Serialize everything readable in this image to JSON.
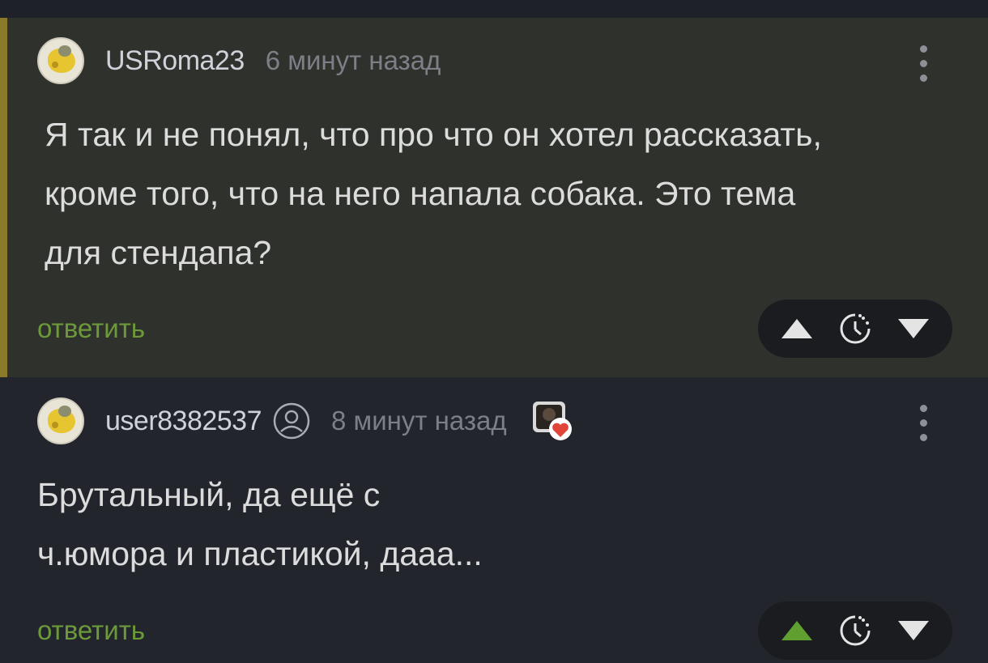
{
  "comments": [
    {
      "username": "USRoma23",
      "time": "6 минут назад",
      "text_lines": [
        "Я так и не понял, что про что он хотел рассказать,",
        "кроме того, что на него напала собака. Это тема",
        "для стендапа?"
      ],
      "reply_label": "ответить",
      "upvoted": false
    },
    {
      "username": "user8382537",
      "time": "8 минут назад",
      "text_lines": [
        "Брутальный, да ещё с",
        "ч.юмора и пластикой, дааа..."
      ],
      "reply_label": "ответить",
      "upvoted": true
    }
  ],
  "colors": {
    "highlight_bg": "#2f312d",
    "accent_bar": "#8a7a2a",
    "reply_green": "#6c9a3a",
    "upvote_active": "#5fa030",
    "vote_inactive": "#e4e4e4"
  },
  "icons": [
    "avatar",
    "more-vertical-icon",
    "upvote-icon",
    "timer-icon",
    "downvote-icon",
    "user-icon",
    "badge-heart-icon"
  ]
}
